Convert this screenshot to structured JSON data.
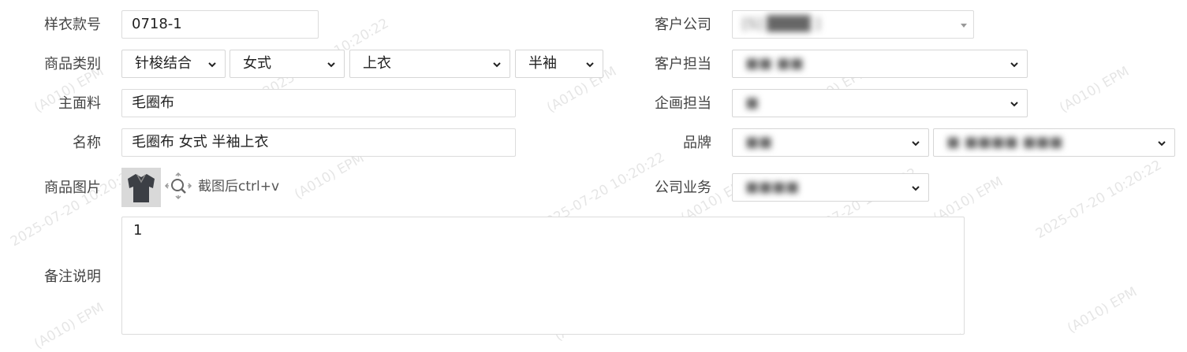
{
  "form": {
    "sample_no": {
      "label": "样衣款号",
      "value": "0718-1"
    },
    "category": {
      "label": "商品类别",
      "selects": [
        "针梭结合",
        "女式",
        "上衣",
        "半袖"
      ]
    },
    "main_fabric": {
      "label": "主面料",
      "value": "毛圈布"
    },
    "name": {
      "label": "名称",
      "value": "毛圈布 女式 半袖上衣"
    },
    "product_image": {
      "label": "商品图片",
      "hint": "截图后ctrl+v"
    },
    "remarks": {
      "label": "备注说明",
      "value": "1"
    },
    "client_company": {
      "label": "客户公司",
      "value": "[S]  ████  ]"
    },
    "client_contact": {
      "label": "客户担当",
      "value": "■■ ■■"
    },
    "planning_contact": {
      "label": "企画担当",
      "value": "■"
    },
    "brand": {
      "label": "品牌",
      "value1": "■■",
      "value2": "■ ■■■■ ■■■"
    },
    "business": {
      "label": "公司业务",
      "value": "■■■■"
    }
  },
  "watermark": {
    "text1": "(A010) EPM",
    "text2": "2025-07-20 10:20:22"
  }
}
